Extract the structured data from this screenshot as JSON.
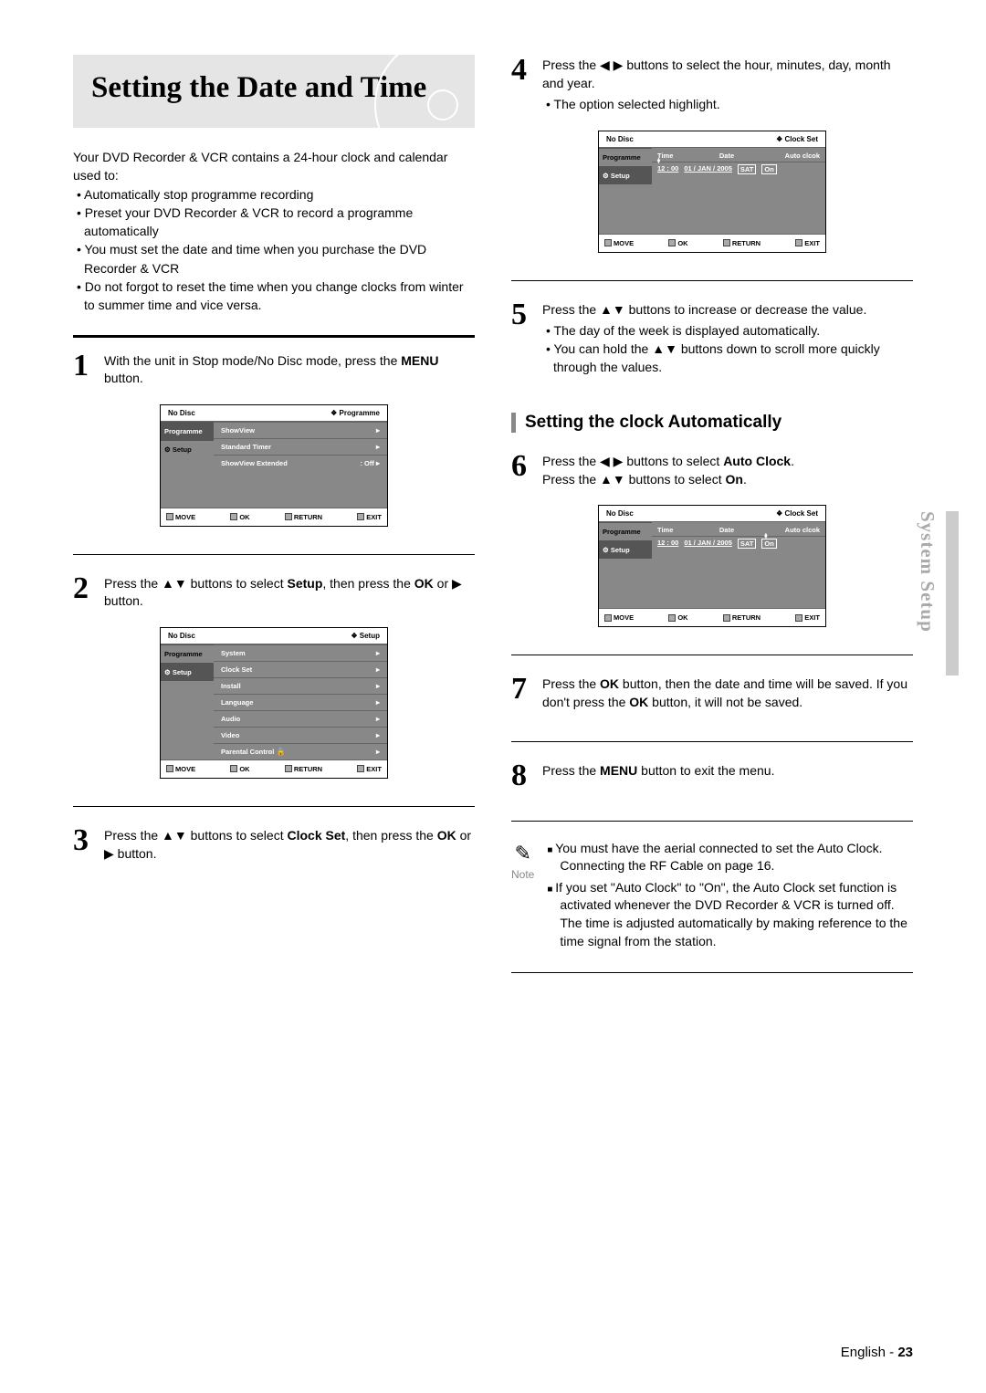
{
  "title": "Setting the Date and Time",
  "side_tab": "System Setup",
  "intro_lead": "Your DVD Recorder & VCR contains a 24-hour clock and calendar used to:",
  "intro_items": [
    "Automatically stop programme recording",
    "Preset your DVD Recorder & VCR to record a programme automatically",
    "You must set the date and time when you purchase the DVD Recorder & VCR",
    "Do not forgot to reset the time when you change clocks from winter to summer time and vice versa."
  ],
  "steps": {
    "s1": {
      "num": "1",
      "pre": "With the unit in Stop mode/No Disc mode, press the ",
      "b": "MENU",
      "post": " button."
    },
    "s2": {
      "num": "2",
      "pre": "Press the ▲▼ buttons to select ",
      "b": "Setup",
      "post": ", then press the ",
      "b2": "OK",
      "post2": " or ▶ button."
    },
    "s3": {
      "num": "3",
      "pre": "Press the ▲▼ buttons to select ",
      "b": "Clock Set",
      "post": ", then press the ",
      "b2": "OK",
      "post2": " or ▶ button."
    },
    "s4": {
      "num": "4",
      "pre": "Press the ◀ ▶ buttons to select the hour, minutes, day, month and year.",
      "bullets": [
        "The option selected highlight."
      ]
    },
    "s5": {
      "num": "5",
      "pre": "Press the ▲▼ buttons to increase or decrease the value.",
      "bullets": [
        "The day of the week is displayed automatically.",
        "You can hold the ▲▼ buttons down to scroll more quickly through the values."
      ]
    },
    "s6": {
      "num": "6",
      "l1a": "Press the ◀ ▶ buttons to select ",
      "l1b": "Auto Clock",
      "l1c": ".",
      "l2a": "Press the ▲▼ buttons to select ",
      "l2b": "On",
      "l2c": "."
    },
    "s7": {
      "num": "7",
      "pre": "Press the ",
      "b": "OK",
      "mid": " button, then the date and time will be saved. If you don't press the ",
      "b2": "OK",
      "post": " button, it will not be saved."
    },
    "s8": {
      "num": "8",
      "pre": "Press the ",
      "b": "MENU",
      "post": " button to exit the menu."
    }
  },
  "subheading": "Setting the clock Automatically",
  "osd_common": {
    "no_disc": "No Disc",
    "move": "MOVE",
    "ok": "OK",
    "return": "RETURN",
    "exit": "EXIT",
    "programme_tab": "Programme",
    "setup_tab": "Setup"
  },
  "osd1": {
    "title": "Programme",
    "rows": [
      {
        "label": "ShowView",
        "val": ""
      },
      {
        "label": "Standard Timer",
        "val": ""
      },
      {
        "label": "ShowView Extended",
        "val": ": Off"
      }
    ]
  },
  "osd2": {
    "title": "Setup",
    "rows": [
      {
        "label": "System",
        "val": ""
      },
      {
        "label": "Clock Set",
        "val": ""
      },
      {
        "label": "Install",
        "val": ""
      },
      {
        "label": "Language",
        "val": ""
      },
      {
        "label": "Audio",
        "val": ""
      },
      {
        "label": "Video",
        "val": ""
      },
      {
        "label": "Parental Control",
        "val": "lock"
      }
    ]
  },
  "osd_clock": {
    "title": "Clock Set",
    "h_time": "Time",
    "h_date": "Date",
    "h_auto": "Auto clcok",
    "time": "12 : 00",
    "date": "01 / JAN / 2005",
    "dow": "SAT",
    "auto": "On"
  },
  "note": {
    "label": "Note",
    "items": [
      "You must have the aerial connected to set the Auto Clock. Connecting the RF Cable on page 16.",
      "If you set \"Auto Clock\" to \"On\", the Auto Clock set function is activated whenever the DVD Recorder & VCR is turned off."
    ],
    "tail": "The time is adjusted automatically by making reference to the time signal from the station."
  },
  "footer": {
    "lang": "English",
    "sep": " - ",
    "page": "23"
  }
}
